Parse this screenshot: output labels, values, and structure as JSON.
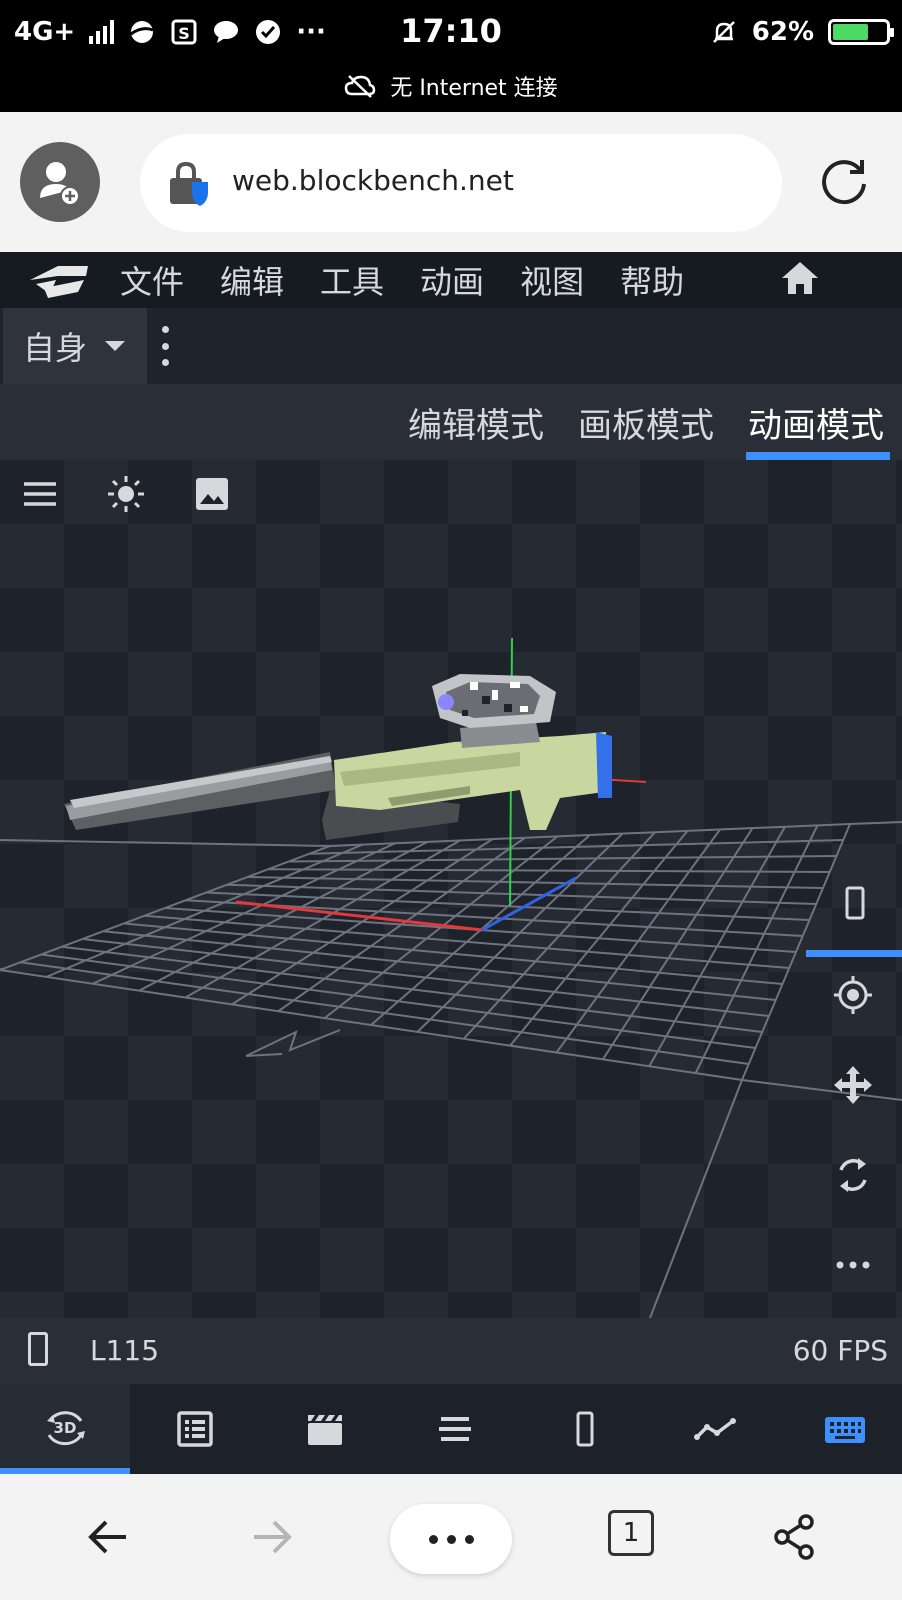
{
  "status_bar": {
    "network": "4G+",
    "time": "17:10",
    "battery": "62%",
    "battery_level": 0.62,
    "connection_notice": "无 Internet 连接"
  },
  "browser": {
    "url": "web.blockbench.net",
    "tab_count": "1"
  },
  "menu": {
    "items": [
      "文件",
      "编辑",
      "工具",
      "动画",
      "视图",
      "帮助"
    ]
  },
  "toolbar": {
    "space_dropdown": "自身"
  },
  "modes": {
    "tabs": [
      "编辑模式",
      "画板模式",
      "动画模式"
    ],
    "active": "动画模式"
  },
  "statusline": {
    "label": "L115",
    "fps": "60 FPS"
  },
  "panel_tabs": [
    "3d-rotate-icon",
    "list-icon",
    "clapperboard-icon",
    "menu-lines-icon",
    "phone-icon",
    "graph-icon",
    "keyboard-icon"
  ],
  "colors": {
    "accent": "#3e90ff",
    "menubar": "#161a21",
    "viewport": "#1e222a"
  }
}
